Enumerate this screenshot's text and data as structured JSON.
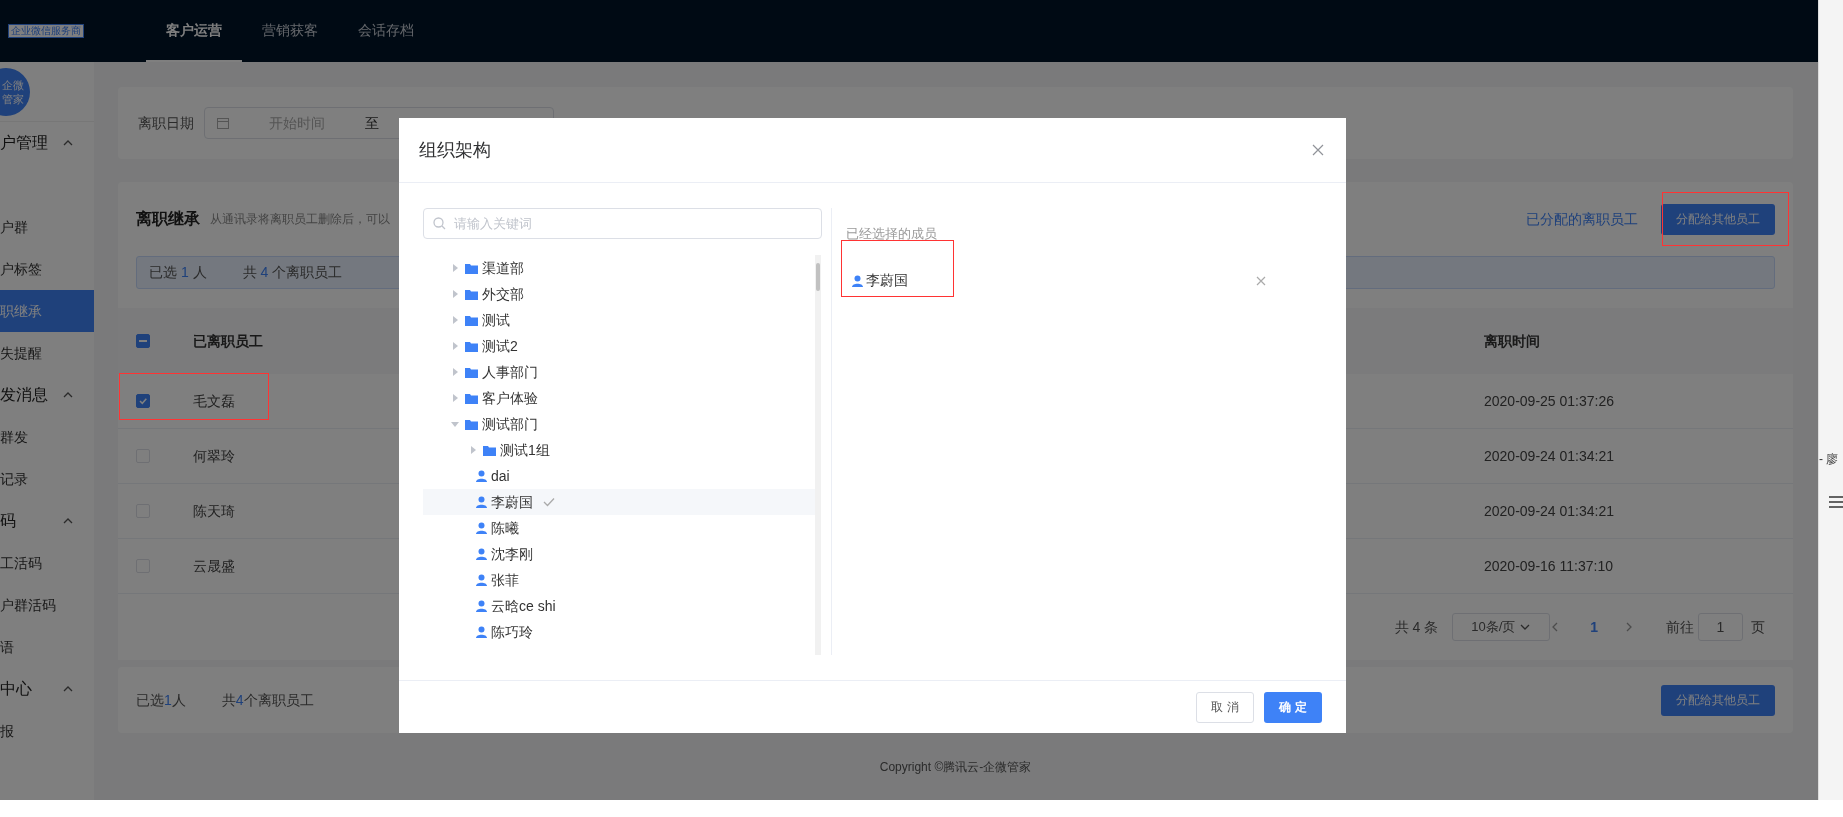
{
  "header": {
    "logo_badge": "企业微信服务商",
    "tabs": [
      {
        "label": "客户运营",
        "selected": true
      },
      {
        "label": "营销获客",
        "selected": false
      },
      {
        "label": "会话存档",
        "selected": false
      }
    ]
  },
  "sidebar": {
    "avatar_lines": [
      "企微",
      "管家"
    ],
    "groups": [
      {
        "label": "户管理",
        "expanded": true,
        "items": [
          {
            "label": "户群",
            "selected": false
          },
          {
            "label": "户标签",
            "selected": false
          },
          {
            "label": "职继承",
            "selected": true
          },
          {
            "label": "失提醒",
            "selected": false
          }
        ]
      },
      {
        "label": "发消息",
        "expanded": true,
        "items": [
          {
            "label": "群发",
            "selected": false
          },
          {
            "label": "记录",
            "selected": false
          }
        ]
      },
      {
        "label": "码",
        "expanded": true,
        "items": [
          {
            "label": "工活码",
            "selected": false
          },
          {
            "label": "户群活码",
            "selected": false
          },
          {
            "label": "语",
            "selected": false
          }
        ]
      },
      {
        "label": "中心",
        "expanded": true,
        "items": [
          {
            "label": "报",
            "selected": false
          }
        ]
      }
    ]
  },
  "filter": {
    "label": "离职日期",
    "start_placeholder": "开始时间",
    "separator": "至"
  },
  "section": {
    "title": "离职继承",
    "description": "从通讯录将离职员工删除后，可以",
    "link": "已分配的离职员工",
    "button": "分配给其他员工",
    "selection_info": {
      "selected_prefix": "已选",
      "selected_count": "1",
      "selected_suffix": "人",
      "total_prefix": "共",
      "total_count": "4",
      "total_suffix": "个离职员工"
    }
  },
  "table": {
    "columns": [
      "已离职员工",
      "离职时间"
    ],
    "select_all": {
      "indeterminate": true
    },
    "rows": [
      {
        "name": "毛文磊",
        "time": "2020-09-25 01:37:26",
        "checked": true
      },
      {
        "name": "何翠玲",
        "time": "2020-09-24 01:34:21",
        "checked": false
      },
      {
        "name": "陈天琦",
        "time": "2020-09-24 01:34:21",
        "checked": false
      },
      {
        "name": "云晟盛",
        "time": "2020-09-16 11:37:10",
        "checked": false
      }
    ]
  },
  "pagination": {
    "total": "共 4 条",
    "page_size": "10条/页",
    "current_page": "1",
    "goto_label": "前往",
    "goto_value": "1",
    "goto_suffix": "页"
  },
  "footer_bar": {
    "selected_prefix": "已选",
    "selected_count": "1",
    "selected_suffix": "人",
    "total_prefix": "共",
    "total_count": "4",
    "total_suffix": "个离职员工",
    "button": "分配给其他员工"
  },
  "copyright": "Copyright ©腾讯云-企微管家",
  "side_window": {
    "text": "- 廖"
  },
  "dialog": {
    "title": "组织架构",
    "search_placeholder": "请输入关键词",
    "selected_heading": "已经选择的成员",
    "selected_members": [
      "李蔚国"
    ],
    "cancel": "取 消",
    "confirm": "确 定",
    "tree": [
      {
        "kind": "folder",
        "label": "渠道部",
        "expanded": false,
        "selected": false
      },
      {
        "kind": "folder",
        "label": "外交部",
        "expanded": false,
        "selected": false
      },
      {
        "kind": "folder",
        "label": "测试",
        "expanded": false,
        "selected": false
      },
      {
        "kind": "folder",
        "label": "测试2",
        "expanded": false,
        "selected": false
      },
      {
        "kind": "folder",
        "label": "人事部门",
        "expanded": false,
        "selected": false
      },
      {
        "kind": "folder",
        "label": "客户体验",
        "expanded": false,
        "selected": false
      },
      {
        "kind": "folder",
        "label": "测试部门",
        "expanded": true,
        "selected": false,
        "children": [
          {
            "kind": "folder",
            "label": "测试1组",
            "expanded": false,
            "selected": false
          },
          {
            "kind": "person",
            "label": "dai",
            "selected": false
          },
          {
            "kind": "person",
            "label": "李蔚国",
            "selected": true
          },
          {
            "kind": "person",
            "label": "陈曦",
            "selected": false
          },
          {
            "kind": "person",
            "label": "沈李刚",
            "selected": false
          },
          {
            "kind": "person",
            "label": "张菲",
            "selected": false
          },
          {
            "kind": "person",
            "label": "云晗ce shi",
            "selected": false
          },
          {
            "kind": "person",
            "label": "陈巧玲",
            "selected": false
          }
        ]
      }
    ]
  }
}
